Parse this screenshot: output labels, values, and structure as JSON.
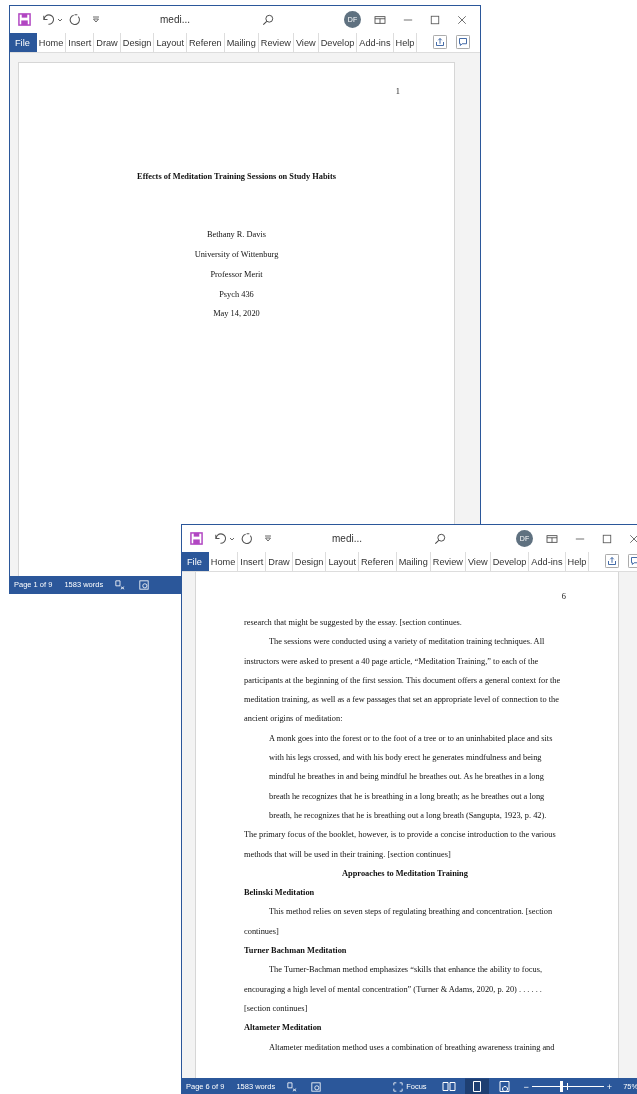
{
  "windows": [
    {
      "title": "medi...",
      "avatar": "DF",
      "ribbon_tabs": [
        {
          "label": "File",
          "kind": "file"
        },
        {
          "label": "Home",
          "kind": "tab"
        },
        {
          "label": "Insert",
          "kind": "tab"
        },
        {
          "label": "Draw",
          "kind": "tab"
        },
        {
          "label": "Design",
          "kind": "tab"
        },
        {
          "label": "Layout",
          "kind": "tab"
        },
        {
          "label": "Referen",
          "kind": "tab"
        },
        {
          "label": "Mailing",
          "kind": "tab"
        },
        {
          "label": "Review",
          "kind": "tab"
        },
        {
          "label": "View",
          "kind": "tab"
        },
        {
          "label": "Develop",
          "kind": "tab"
        },
        {
          "label": "Add-ins",
          "kind": "tab"
        },
        {
          "label": "Help",
          "kind": "tab"
        }
      ],
      "page": {
        "page_number": "1",
        "blocks": [
          {
            "kind": "title",
            "text": "Effects of Meditation Training Sessions on Study Habits"
          },
          {
            "kind": "center",
            "text": "Bethany R. Davis"
          },
          {
            "kind": "center",
            "text": "University of Wittenburg"
          },
          {
            "kind": "center",
            "text": "Professor Merit"
          },
          {
            "kind": "center",
            "text": "Psych 436"
          },
          {
            "kind": "center",
            "text": "May 14, 2020"
          }
        ]
      },
      "status_bar": {
        "page": "Page 1 of 9",
        "words": "1583 words"
      }
    },
    {
      "title": "medi...",
      "avatar": "DF",
      "ribbon_tabs": [
        {
          "label": "File",
          "kind": "file"
        },
        {
          "label": "Home",
          "kind": "tab"
        },
        {
          "label": "Insert",
          "kind": "tab"
        },
        {
          "label": "Draw",
          "kind": "tab"
        },
        {
          "label": "Design",
          "kind": "tab"
        },
        {
          "label": "Layout",
          "kind": "tab"
        },
        {
          "label": "Referen",
          "kind": "tab"
        },
        {
          "label": "Mailing",
          "kind": "tab"
        },
        {
          "label": "Review",
          "kind": "tab"
        },
        {
          "label": "View",
          "kind": "tab"
        },
        {
          "label": "Develop",
          "kind": "tab"
        },
        {
          "label": "Add-ins",
          "kind": "tab"
        },
        {
          "label": "Help",
          "kind": "tab"
        }
      ],
      "page": {
        "page_number": "6",
        "blocks": [
          {
            "kind": "cont",
            "text": "research that might be suggested by the essay. [section continues."
          },
          {
            "kind": "para",
            "text": "The sessions were conducted using a variety of meditation training techniques. All instructors were asked to present a 40 page article, “Meditation Training,” to each of the participants at the beginning of the first session.  This document offers a general context for the meditation training, as well as a few passages that set an appropriate level of connection to the ancient origins of meditation:"
          },
          {
            "kind": "quote",
            "text": "A monk goes into the forest or to the foot of a tree or to an uninhabited place and sits with his legs crossed, and with his body erect he generates mindfulness and being mindful he breathes in and being mindful he breathes out. As he breathes in a long breath he recognizes that he is breathing in a long breath; as he breathes out a long breath, he recognizes that he is breathing out a long breath (Sangupta, 1923, p. 42)."
          },
          {
            "kind": "cont",
            "text": "The primary focus of the booklet, however, is to provide a concise introduction to the various methods that will be used in their training.  [section continues]"
          },
          {
            "kind": "hcenter",
            "text": "Approaches to Meditation Training"
          },
          {
            "kind": "heading",
            "text": "Belinski Meditation"
          },
          {
            "kind": "para",
            "text": "This method relies on seven steps of regulating breathing and concentration. [section continues]"
          },
          {
            "kind": "heading",
            "text": "Turner Bachman Meditation"
          },
          {
            "kind": "para",
            "text": "The Turner-Bachman method emphasizes “skills that enhance the ability to focus, encouraging a high level of mental concentration” (Turner & Adams, 2020, p. 20) . . . . . . [section continues]"
          },
          {
            "kind": "heading",
            "text": "Altameter Meditation"
          },
          {
            "kind": "para",
            "text": "Altameter meditation method uses a combination of breathing awareness training and"
          }
        ]
      },
      "status_bar": {
        "page": "Page 6 of 9",
        "words": "1583 words",
        "focus": "Focus",
        "view_buttons": [
          {
            "kind": "read",
            "selected": false
          },
          {
            "kind": "print",
            "selected": true
          },
          {
            "kind": "web",
            "selected": false
          }
        ],
        "zoom": {
          "minus": "−",
          "plus": "+",
          "level": 0.4,
          "reading": "75%"
        }
      }
    }
  ]
}
